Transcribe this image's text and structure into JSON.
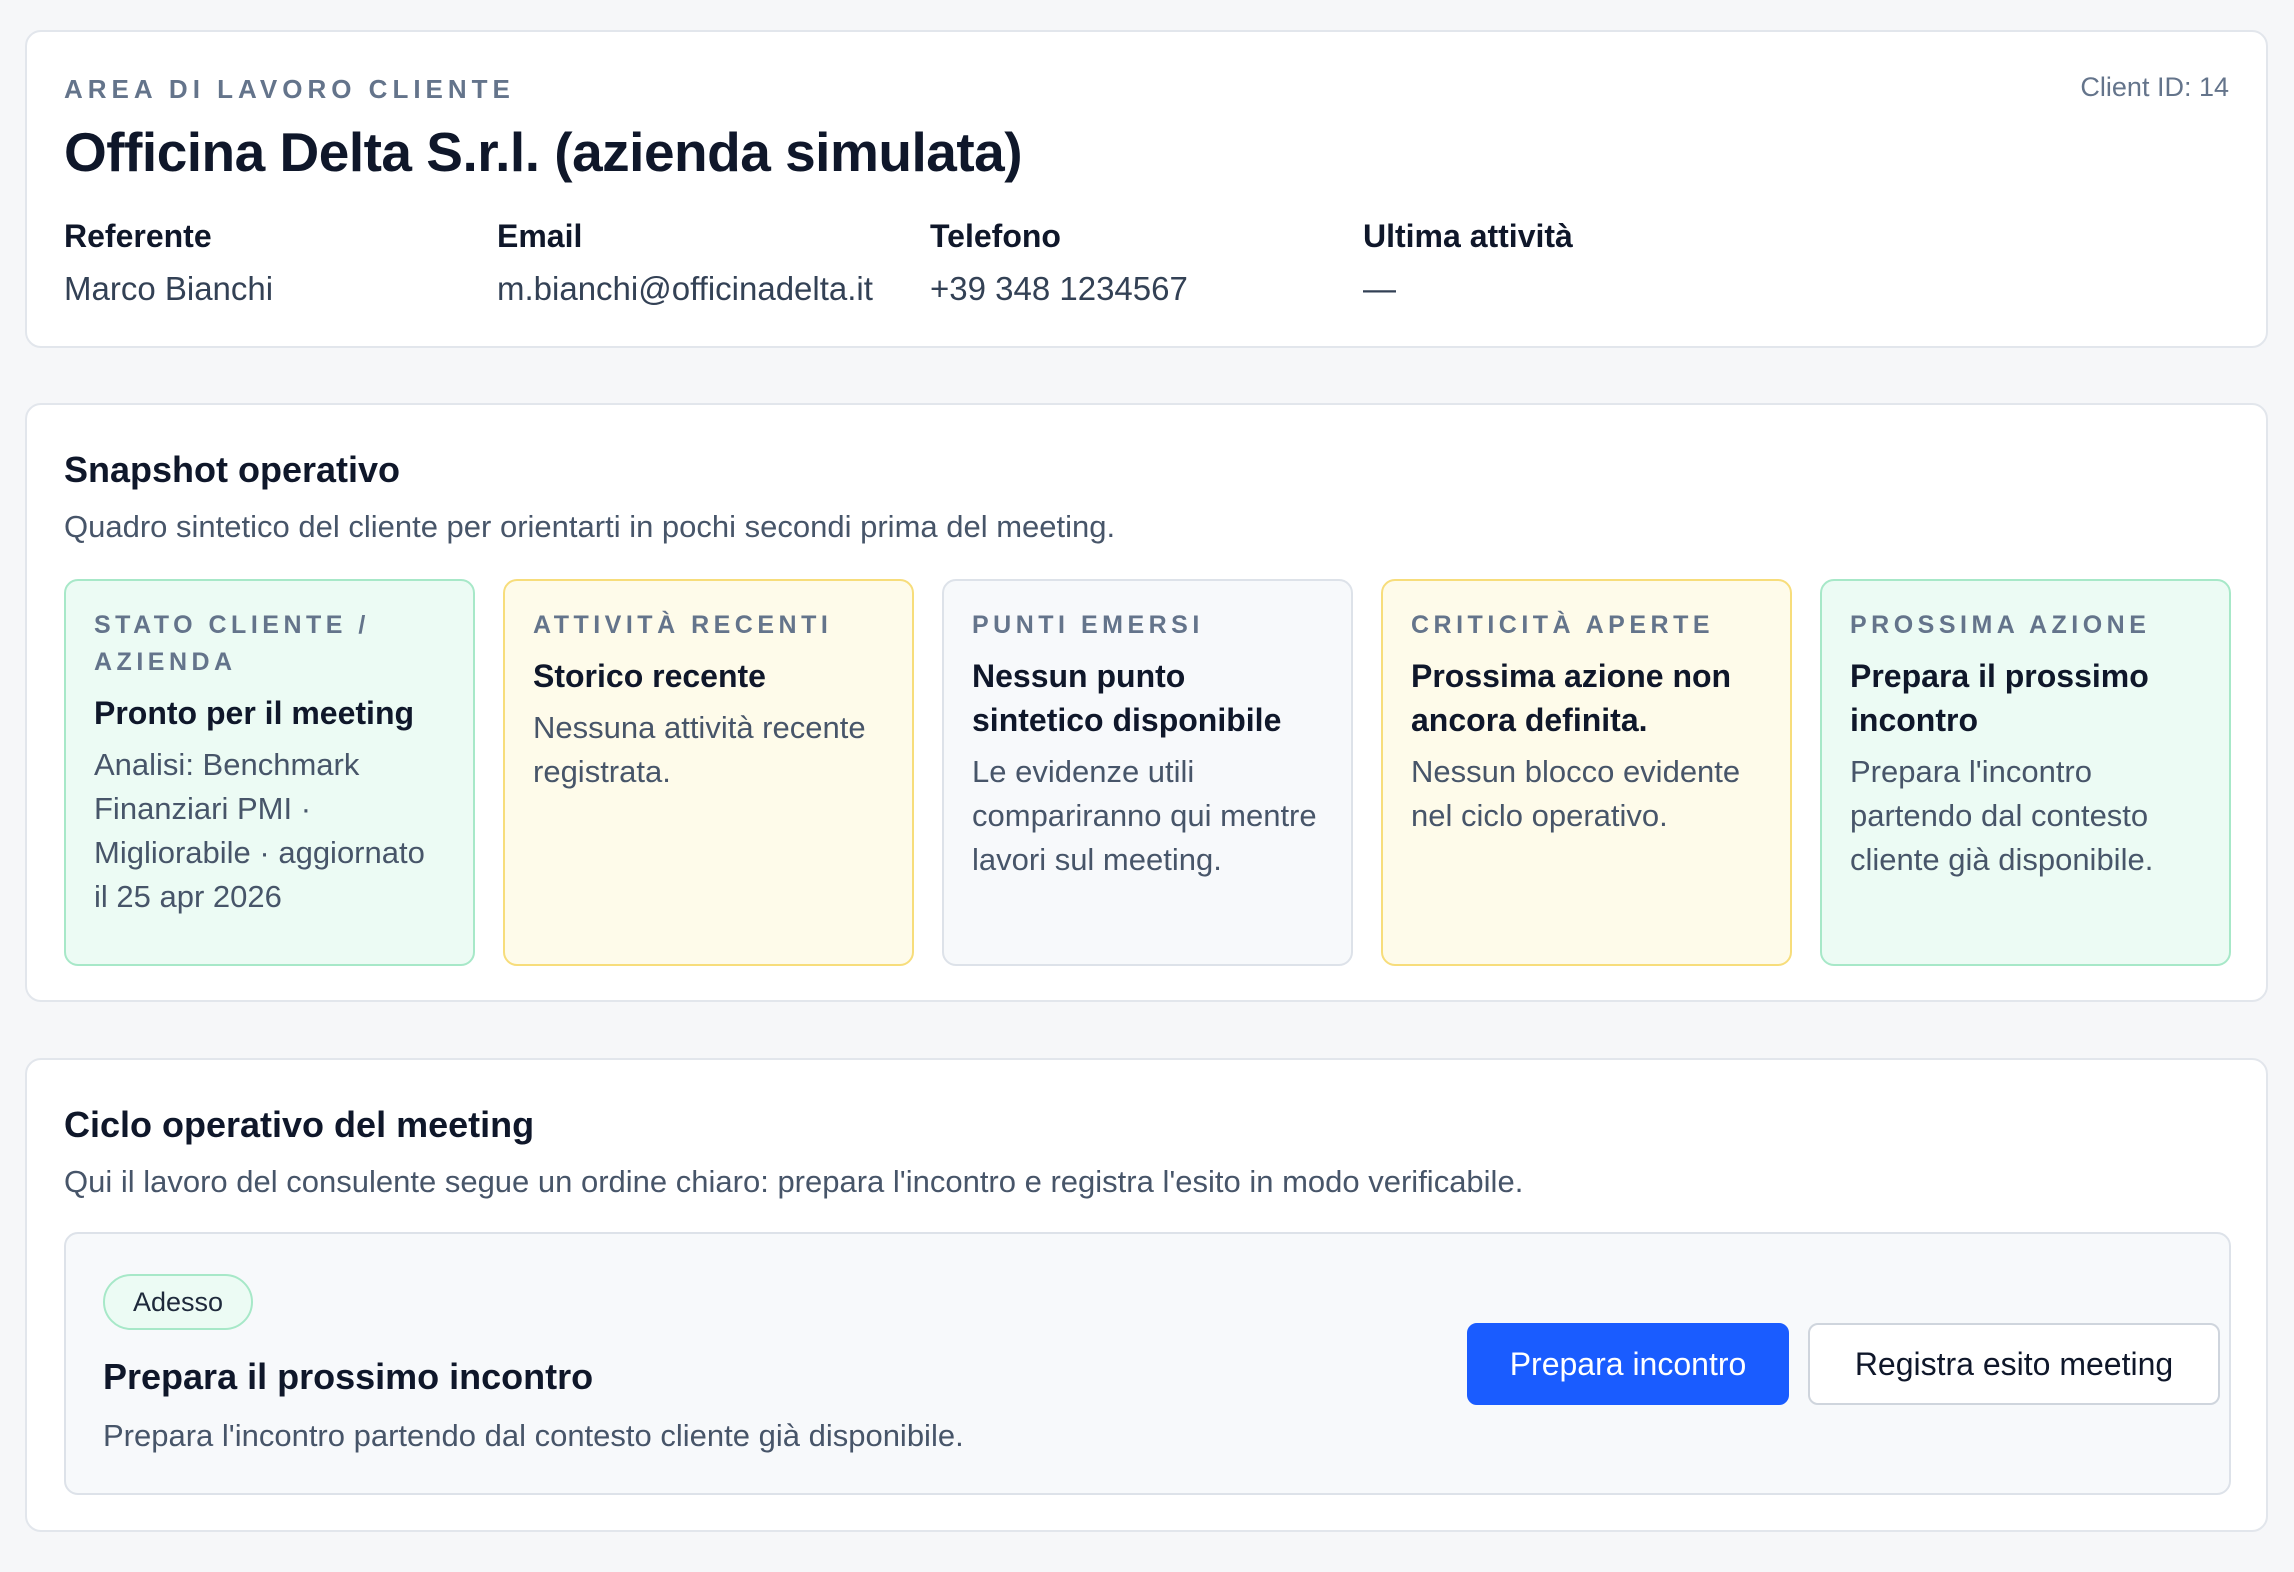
{
  "header": {
    "eyebrow": "AREA DI LAVORO CLIENTE",
    "client_id": "Client ID: 14",
    "title": "Officina Delta S.r.l. (azienda simulata)",
    "fields": [
      {
        "label": "Referente",
        "value": "Marco Bianchi"
      },
      {
        "label": "Email",
        "value": "m.bianchi@officinadelta.it"
      },
      {
        "label": "Telefono",
        "value": "+39 348 1234567"
      },
      {
        "label": "Ultima attività",
        "value": "—"
      }
    ]
  },
  "snapshot": {
    "title": "Snapshot operativo",
    "description": "Quadro sintetico del cliente per orientarti in pochi secondi prima del meeting.",
    "cards": [
      {
        "kicker": "STATO CLIENTE / AZIENDA",
        "head": "Pronto per il meeting",
        "body": "Analisi: Benchmark Finanziari PMI · Migliorabile · aggiornato il 25 apr 2026",
        "tone": "green"
      },
      {
        "kicker": "ATTIVITÀ RECENTI",
        "head": "Storico recente",
        "body": "Nessuna attività recente registrata.",
        "tone": "yellow"
      },
      {
        "kicker": "PUNTI EMERSI",
        "head": "Nessun punto sintetico disponibile",
        "body": "Le evidenze utili compariranno qui mentre lavori sul meeting.",
        "tone": "gray"
      },
      {
        "kicker": "CRITICITÀ APERTE",
        "head": "Prossima azione non ancora definita.",
        "body": "Nessun blocco evidente nel ciclo operativo.",
        "tone": "yellow"
      },
      {
        "kicker": "PROSSIMA AZIONE",
        "head": "Prepara il prossimo incontro",
        "body": "Prepara l'incontro partendo dal contesto cliente già disponibile.",
        "tone": "green"
      }
    ]
  },
  "cycle": {
    "title": "Ciclo operativo del meeting",
    "description": "Qui il lavoro del consulente segue un ordine chiaro: prepara l'incontro e registra l'esito in modo verificabile.",
    "step": {
      "badge": "Adesso",
      "title": "Prepara il prossimo incontro",
      "description": "Prepara l'incontro partendo dal contesto cliente già disponibile."
    },
    "buttons": {
      "primary": "Prepara incontro",
      "secondary": "Registra esito meeting"
    }
  },
  "colors": {
    "accent": "#1a5cff",
    "green_bg": "#ecfbf4",
    "yellow_bg": "#fefbea",
    "gray_bg": "#f7f9fb"
  }
}
